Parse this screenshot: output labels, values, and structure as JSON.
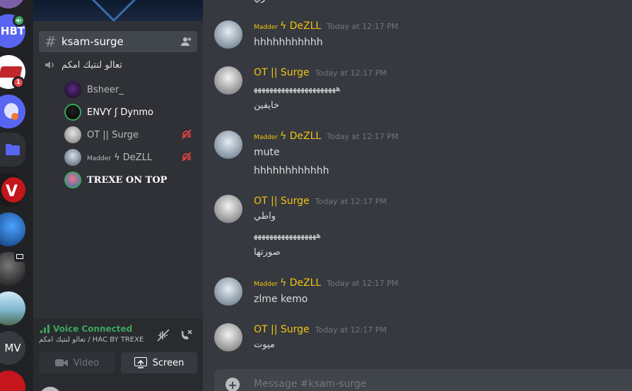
{
  "app": {
    "accent": "#5865f2"
  },
  "servers": [
    {
      "label": "HBT",
      "color": "#5865f2"
    },
    {
      "label": "MV",
      "color": "#36393f"
    }
  ],
  "badges": {
    "mention_count": "1"
  },
  "channel": {
    "text_name": "ksam-surge",
    "voice_name": "تعالو لنتيك امكم"
  },
  "voice_users": [
    {
      "name": "Bsheer_"
    },
    {
      "name": "ENVY ʃ Dynmo"
    },
    {
      "name": "OT || Surge"
    },
    {
      "prefix": "Madder",
      "name": "ϟ DeZLL"
    },
    {
      "name": "TREXE ON TOP"
    }
  ],
  "voice_panel": {
    "status": "Voice Connected",
    "subtitle": "تعالو لنتيك امكم / HAC BY TREXE",
    "video_label": "Video",
    "screen_label": "Screen"
  },
  "messages": [
    {
      "prefix": "Madder",
      "author": "ϟ DeZLL",
      "time": "Today at 12:17 PM",
      "lines": [
        "hhhhhhhhhhh"
      ]
    },
    {
      "prefix": "",
      "author": "OT || Surge",
      "time": "Today at 12:17 PM",
      "lines": [
        "ﻫﻬﻬﻬﻬﻬﻬﻬﻬﻬﻬﻬﻬﻬﻬﻬﻬﻬﻬﻬﻬﻬ",
        "خايفين"
      ]
    },
    {
      "prefix": "Madder",
      "author": "ϟ DeZLL",
      "time": "Today at 12:17 PM",
      "lines": [
        "mute",
        "hhhhhhhhhhhh"
      ]
    },
    {
      "prefix": "",
      "author": "OT || Surge",
      "time": "Today at 12:17 PM",
      "lines": [
        "واطي",
        "ﻫﻬﻬﻬﻬﻬﻬﻬﻬﻬﻬﻬﻬﻬﻬﻬﻬ",
        "صورتها"
      ]
    },
    {
      "prefix": "Madder",
      "author": "ϟ DeZLL",
      "time": "Today at 12:17 PM",
      "lines": [
        "zlme kemo"
      ]
    },
    {
      "prefix": "",
      "author": "OT || Surge",
      "time": "Today at 12:17 PM",
      "lines": [
        "ميوت"
      ]
    }
  ],
  "composer": {
    "placeholder": "Message #ksam-surge"
  }
}
